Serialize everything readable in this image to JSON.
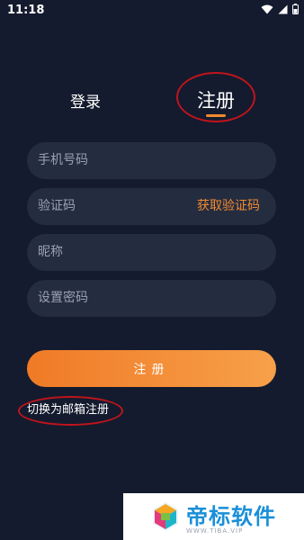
{
  "status_bar": {
    "time": "11:18",
    "icons": [
      "wifi-icon",
      "signal-icon",
      "battery-icon"
    ]
  },
  "tabs": {
    "login_label": "登录",
    "register_label": "注册",
    "active": "register"
  },
  "form": {
    "phone_placeholder": "手机号码",
    "code_placeholder": "验证码",
    "get_code_label": "获取验证码",
    "nickname_placeholder": "昵称",
    "password_placeholder": "设置密码",
    "submit_label": "注册"
  },
  "switch_link_label": "切换为邮箱注册",
  "watermark": {
    "title": "帝标软件",
    "url": "WWW.TIBA.VIP"
  },
  "colors": {
    "background": "#141b2e",
    "field": "#242c40",
    "accent": "#f28a2f",
    "annotation_ring": "#c0141c"
  }
}
